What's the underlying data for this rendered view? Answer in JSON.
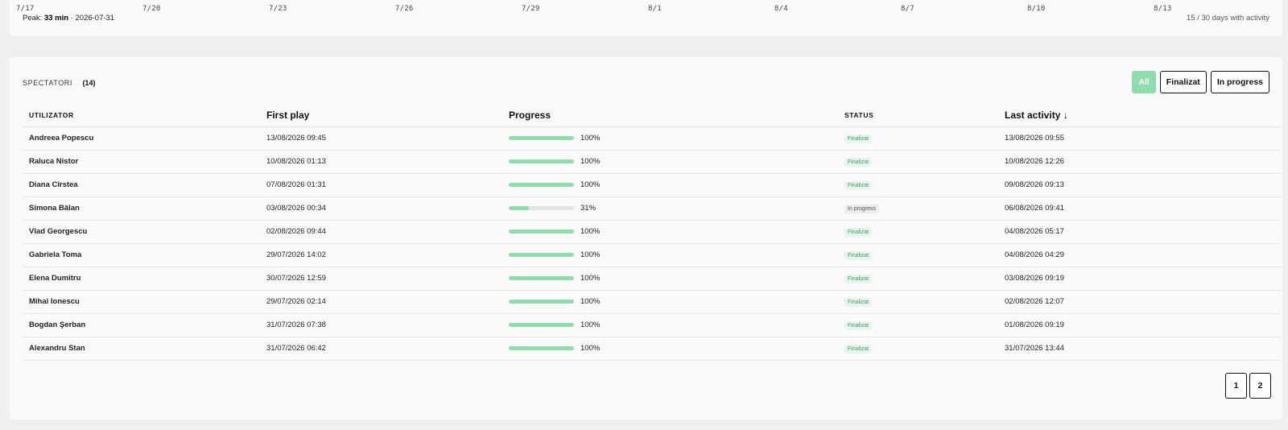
{
  "chart": {
    "ticks": [
      "7/17",
      "7/20",
      "7/23",
      "7/26",
      "7/29",
      "8/1",
      "8/4",
      "8/7",
      "8/10",
      "8/13"
    ],
    "peak_label": "Peak:",
    "peak_value": "33 min",
    "peak_sep": " · ",
    "peak_date": "2026-07-31",
    "days_active": "15 / 30 days with activity"
  },
  "spectators": {
    "title": "SPECTATORI",
    "count": "(14)",
    "filters": [
      {
        "label": "All",
        "active": true
      },
      {
        "label": "Finalizat",
        "active": false
      },
      {
        "label": "In progress",
        "active": false
      }
    ],
    "columns": {
      "user": "UTILIZATOR",
      "first_play": "First play",
      "progress": "Progress",
      "status": "STATUS",
      "last_activity": "Last activity ↓"
    },
    "rows": [
      {
        "name": "Andreea Popescu",
        "first_play": "13/08/2026 09:45",
        "progress": 100,
        "progress_label": "100%",
        "status": "Finalizat",
        "last_activity": "13/08/2026 09:55"
      },
      {
        "name": "Raluca Nistor",
        "first_play": "10/08/2026 01:13",
        "progress": 100,
        "progress_label": "100%",
        "status": "Finalizat",
        "last_activity": "10/08/2026 12:26"
      },
      {
        "name": "Diana Cîrstea",
        "first_play": "07/08/2026 01:31",
        "progress": 100,
        "progress_label": "100%",
        "status": "Finalizat",
        "last_activity": "09/08/2026 09:13"
      },
      {
        "name": "Simona Bălan",
        "first_play": "03/08/2026 00:34",
        "progress": 31,
        "progress_label": "31%",
        "status": "In progress",
        "last_activity": "06/08/2026 09:41"
      },
      {
        "name": "Vlad Georgescu",
        "first_play": "02/08/2026 09:44",
        "progress": 100,
        "progress_label": "100%",
        "status": "Finalizat",
        "last_activity": "04/08/2026 05:17"
      },
      {
        "name": "Gabriela Toma",
        "first_play": "29/07/2026 14:02",
        "progress": 100,
        "progress_label": "100%",
        "status": "Finalizat",
        "last_activity": "04/08/2026 04:29"
      },
      {
        "name": "Elena Dumitru",
        "first_play": "30/07/2026 12:59",
        "progress": 100,
        "progress_label": "100%",
        "status": "Finalizat",
        "last_activity": "03/08/2026 09:19"
      },
      {
        "name": "Mihai Ionescu",
        "first_play": "29/07/2026 02:14",
        "progress": 100,
        "progress_label": "100%",
        "status": "Finalizat",
        "last_activity": "02/08/2026 12:07"
      },
      {
        "name": "Bogdan Şerban",
        "first_play": "31/07/2026 07:38",
        "progress": 100,
        "progress_label": "100%",
        "status": "Finalizat",
        "last_activity": "01/08/2026 09:19"
      },
      {
        "name": "Alexandru Stan",
        "first_play": "31/07/2026 06:42",
        "progress": 100,
        "progress_label": "100%",
        "status": "Finalizat",
        "last_activity": "31/07/2026 13:44"
      }
    ],
    "pages": [
      "1",
      "2"
    ]
  },
  "colors": {
    "accent": "#8fdcac",
    "status_done_bg": "#e8f5ec",
    "status_done_text": "#3d9a63"
  }
}
